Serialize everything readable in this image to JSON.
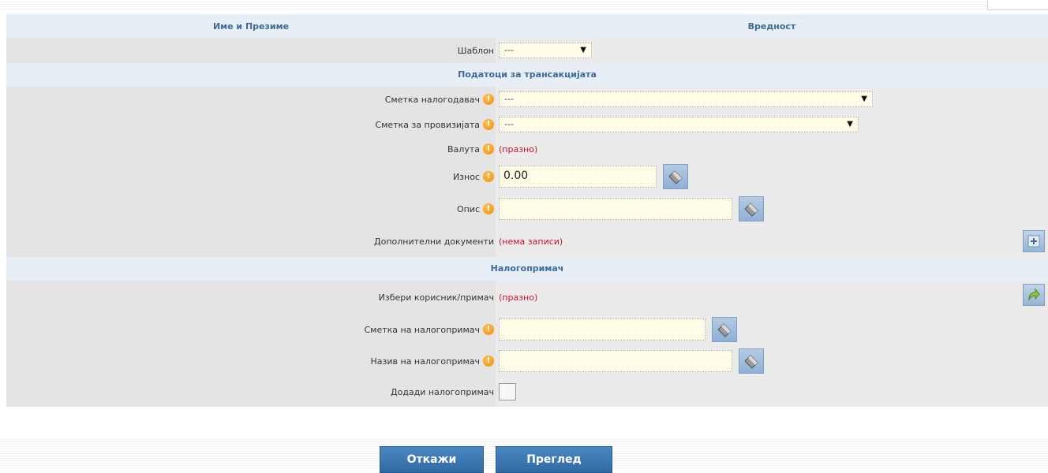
{
  "header": {
    "name_col": "Име и Презиме",
    "value_col": "Вредност"
  },
  "template": {
    "label": "Шаблон",
    "value": "---"
  },
  "section_transaction": "Податоци за трансакцијата",
  "debit_account": {
    "label": "Сметка налогодавач",
    "value": "---"
  },
  "fee_account": {
    "label": "Сметка за провизијата",
    "value": "---"
  },
  "currency": {
    "label": "Валута",
    "value": "(празно)"
  },
  "amount": {
    "label": "Износ",
    "value": "0.00"
  },
  "description": {
    "label": "Опис",
    "value": ""
  },
  "additional_docs": {
    "label": "Дополнителни документи",
    "value": "(нема записи)"
  },
  "section_recipient": "Налогопримач",
  "choose_recipient": {
    "label": "Избери корисник/примач",
    "value": "(празно)"
  },
  "recipient_account": {
    "label": "Сметка на налогопримач",
    "value": ""
  },
  "recipient_name": {
    "label": "Назив на налогопримач",
    "value": ""
  },
  "add_recipient": {
    "label": "Додади налогопримач"
  },
  "buttons": {
    "cancel": "Откажи",
    "preview": "Преглед"
  },
  "icons": {
    "required": "info-exclamation-icon",
    "clear": "eraser-icon",
    "add": "plus-icon",
    "select_recipient": "arrow-forward-icon"
  },
  "colors": {
    "header_text": "#3d6a9a",
    "button_bg": "#3a76b0",
    "empty_note": "#d0102b",
    "field_bg": "#fffde7"
  }
}
